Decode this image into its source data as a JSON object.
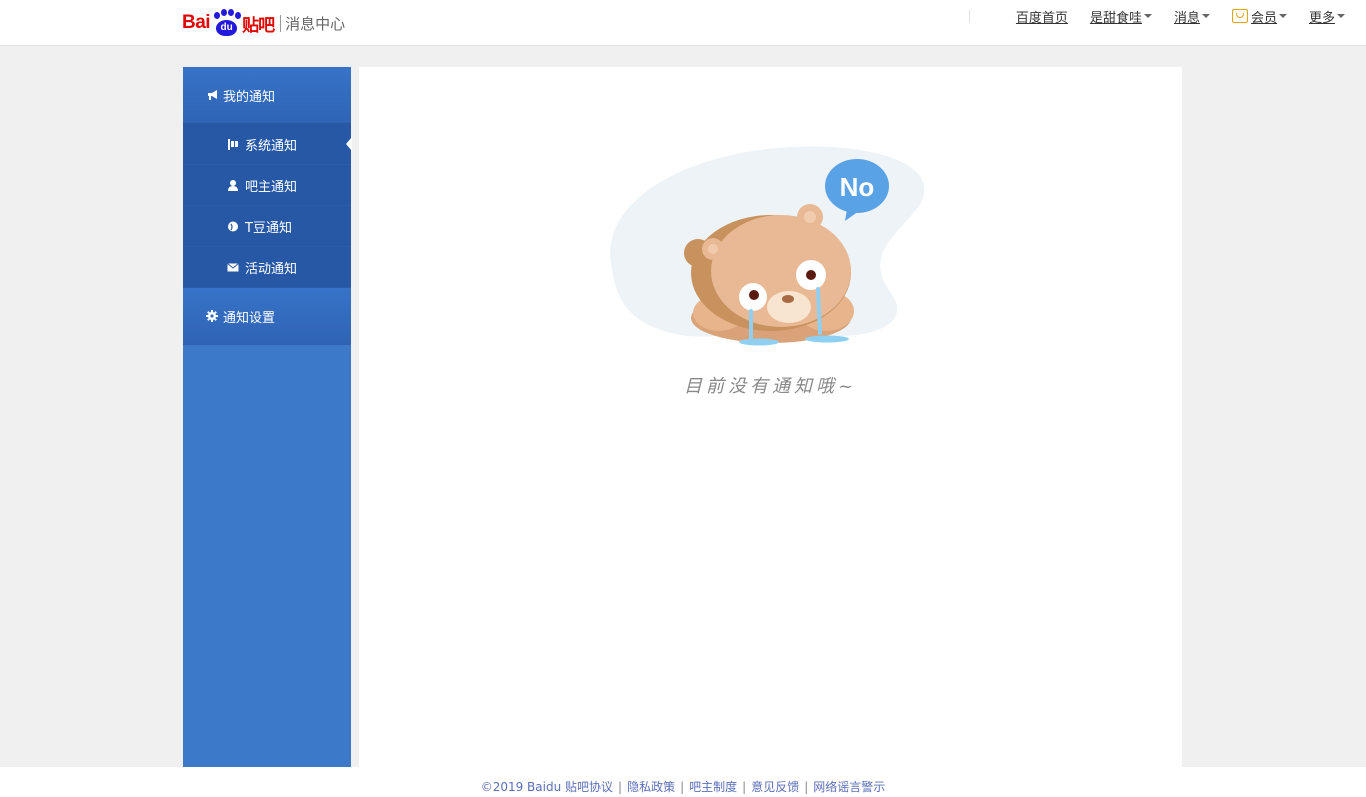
{
  "header": {
    "logo_bai": "Bai",
    "logo_du": "du",
    "logo_tieba": "贴吧",
    "logo_center": "消息中心",
    "nav": {
      "home": "百度首页",
      "user": "是甜食哇",
      "messages": "消息",
      "vip": "会员",
      "more": "更多"
    }
  },
  "sidebar": {
    "my_notice": "我的通知",
    "items": [
      {
        "label": "系统通知",
        "icon": "flag-icon",
        "active": true
      },
      {
        "label": "吧主通知",
        "icon": "user-icon",
        "active": false
      },
      {
        "label": "T豆通知",
        "icon": "bean-icon",
        "active": false
      },
      {
        "label": "活动通知",
        "icon": "envelope-icon",
        "active": false
      }
    ],
    "settings": "通知设置"
  },
  "main": {
    "empty_text": "目前没有通知哦~",
    "bubble_text": "No"
  },
  "footer": {
    "copyright": "©2019 Baidu",
    "links": [
      "贴吧协议",
      "隐私政策",
      "吧主制度",
      "意见反馈",
      "网络谣言警示"
    ]
  },
  "colors": {
    "brand_red": "#e10601",
    "brand_blue": "#2319dc",
    "sidebar_blue": "#3c79c9",
    "sidebar_dark": "#2758a6",
    "footer_link": "#5b6fb8"
  }
}
